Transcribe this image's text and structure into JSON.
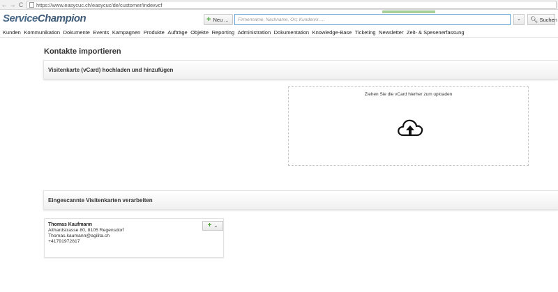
{
  "browser": {
    "back_icon": "←",
    "forward_icon": "→",
    "reload_icon": "C",
    "url": "https://www.easycuc.ch/easycuc/de/customer/indexvcf"
  },
  "header": {
    "logo_a": "Service",
    "logo_b": "Champion",
    "new_button_label": "Neu ...",
    "search_placeholder": "Firmenname, Nachname, Ort, Kundennr. ...",
    "search_dropdown_icon": "⌄",
    "search_button_label": "Suchen"
  },
  "nav": {
    "items": [
      "Kunden",
      "Kommunikation",
      "Dokumente",
      "Events",
      "Kampagnen",
      "Produkte",
      "Aufträge",
      "Objekte",
      "Reporting",
      "Administration",
      "Dokumentation",
      "Knowledge-Base",
      "Ticketing",
      "Newsletter",
      "Zeit- & Spesenerfassung"
    ]
  },
  "page": {
    "title": "Kontakte importieren",
    "upload_section_title": "Visitenkarte (vCard) hochladen und hinzufügen",
    "dropzone_text": "Ziehen Sie die vCard hierher zum uploaden",
    "scanned_section_title": "Eingescannte Visitenkarten verarbeiten"
  },
  "card": {
    "name": "Thomas Kaufmann",
    "address": "Althardstrasse 80, 8105 Regensdorf",
    "email": "Thomas.kaumann@agilita.ch",
    "phone": "+41791972817",
    "action_dropdown_icon": "⌄"
  },
  "colors": {
    "logo": "#4a6a88",
    "accent_green": "#4aa13a",
    "search_border": "#6ea8d8"
  }
}
